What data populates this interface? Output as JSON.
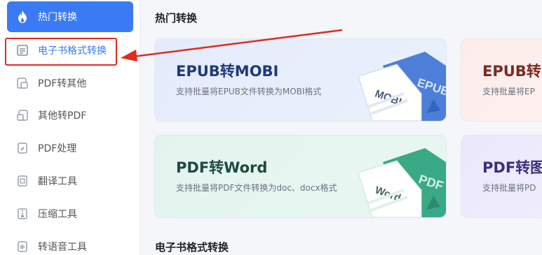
{
  "sidebar": {
    "items": [
      {
        "label": "热门转换",
        "icon": "flame-icon"
      },
      {
        "label": "电子书格式转换",
        "icon": "ebook-icon"
      },
      {
        "label": "PDF转其他",
        "icon": "pdf-convert-icon"
      },
      {
        "label": "其他转PDF",
        "icon": "to-pdf-icon"
      },
      {
        "label": "PDF处理",
        "icon": "pdf-edit-icon"
      },
      {
        "label": "翻译工具",
        "icon": "translate-icon"
      },
      {
        "label": "压缩工具",
        "icon": "compress-icon"
      },
      {
        "label": "转语音工具",
        "icon": "speech-icon"
      }
    ]
  },
  "main": {
    "section_hot": "热门转换",
    "section_ebook": "电子书格式转换",
    "cards": [
      {
        "title": "EPUB转MOBI",
        "desc": "支持批量将EPUB文件转换为MOBI格式",
        "front": "MOBI",
        "back": "EPUB"
      },
      {
        "title": "EPUB转",
        "desc": "支持批量将EP"
      },
      {
        "title": "PDF转Word",
        "desc": "支持批量将PDF文件转换为doc、docx格式",
        "front": "Word",
        "back": "PDF"
      },
      {
        "title": "PDF转图",
        "desc": "支持批量将PD"
      }
    ]
  },
  "colors": {
    "accent": "#3a7af5",
    "highlight_box": "#e02b20",
    "arrow": "#e02b20"
  }
}
